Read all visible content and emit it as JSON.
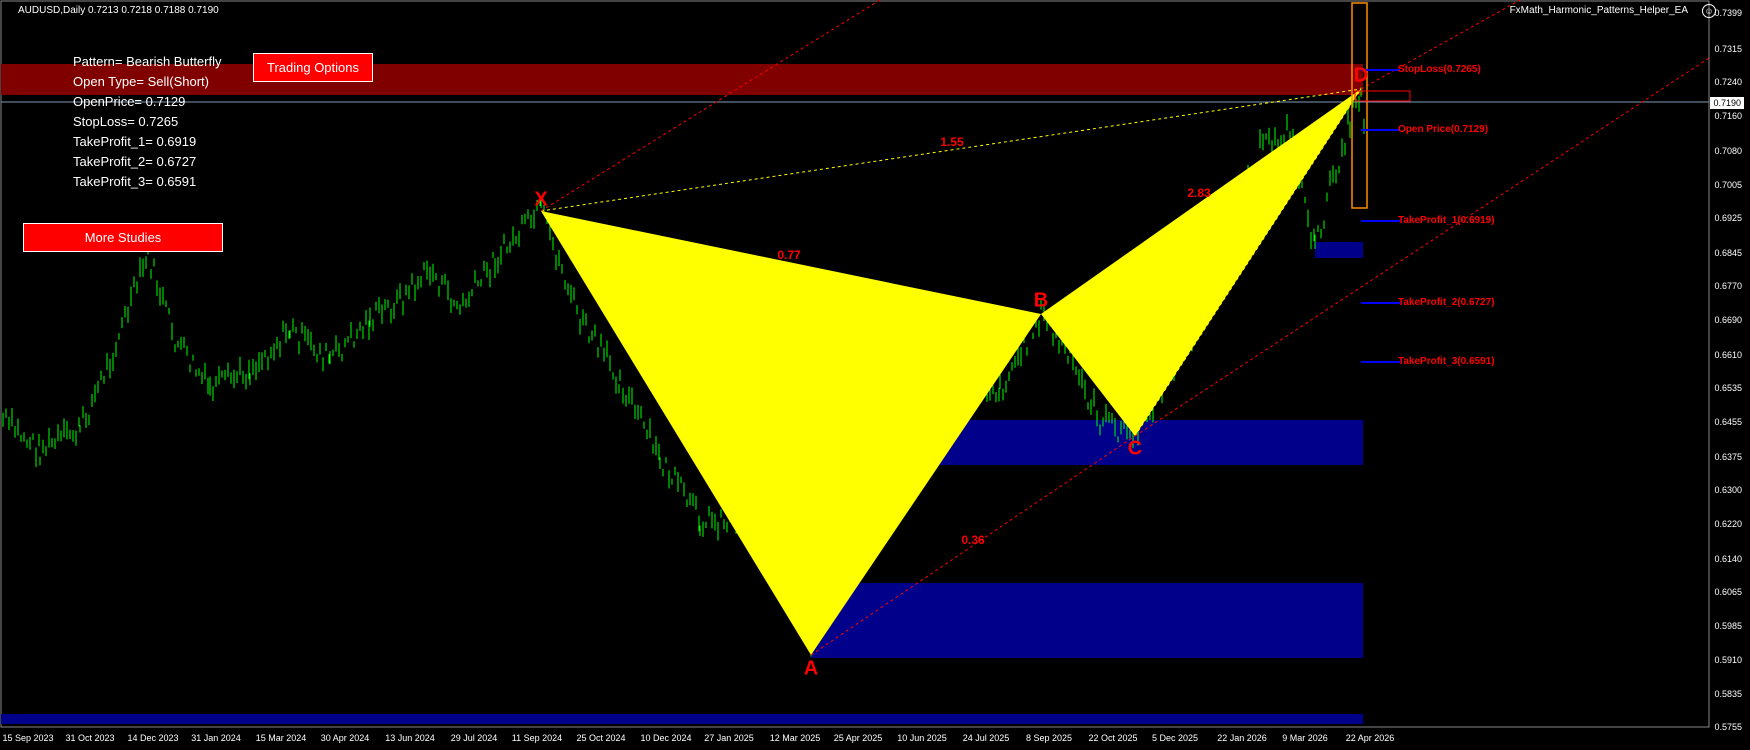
{
  "header": {
    "symbol": "AUDUSD,Daily  0.7213 0.7218 0.7188 0.7190",
    "ea_name": "FxMath_Harmonic_Patterns_Helper_EA",
    "ea_icon": "smiley-icon"
  },
  "info_panel": [
    "Pattern= Bearish Butterfly",
    "Open Type= Sell(Short)",
    "OpenPrice= 0.7129",
    "StopLoss= 0.7265",
    "TakeProfit_1= 0.6919",
    "TakeProfit_2= 0.6727",
    "TakeProfit_3= 0.6591"
  ],
  "buttons": {
    "trading_options": "Trading Options",
    "more_studies": "More Studies"
  },
  "price_axis": {
    "labels": [
      "0.7399",
      "0.7315",
      "0.7240",
      "0.7160",
      "0.7080",
      "0.7005",
      "0.6925",
      "0.6845",
      "0.6770",
      "0.6690",
      "0.6610",
      "0.6535",
      "0.6455",
      "0.6375",
      "0.6300",
      "0.6220",
      "0.6140",
      "0.6065",
      "0.5985",
      "0.5910",
      "0.5835",
      "0.5755"
    ],
    "current": "0.7190"
  },
  "date_axis": [
    "15 Sep 2023",
    "31 Oct 2023",
    "14 Dec 2023",
    "31 Jan 2024",
    "15 Mar 2024",
    "30 Apr 2024",
    "13 Jun 2024",
    "29 Jul 2024",
    "11 Sep 2024",
    "25 Oct 2024",
    "10 Dec 2024",
    "27 Jan 2025",
    "12 Mar 2025",
    "25 Apr 2025",
    "10 Jun 2025",
    "24 Jul 2025",
    "8 Sep 2025",
    "22 Oct 2025",
    "5 Dec 2025",
    "22 Jan 2026",
    "9 Mar 2026",
    "22 Apr 2026"
  ],
  "pattern_points": {
    "x": "X",
    "a": "A",
    "b": "B",
    "c": "C",
    "d": "D"
  },
  "ratios": {
    "xb": "0.77",
    "xd": "1.55",
    "bd": "2.83",
    "ac": "0.36"
  },
  "levels": {
    "stoploss": "StopLoss(0.7265)",
    "open": "Open Price(0.7129)",
    "tp1": "TakeProfit_1(0.6919)",
    "tp2": "TakeProfit_2(0.6727)",
    "tp3": "TakeProfit_3(0.6591)"
  },
  "colors": {
    "background": "#000000",
    "candles": "#00ff00",
    "pattern_fill": "#ffff00",
    "supply_zone": "#800000",
    "demand_zone": "#00008b",
    "level_line": "#0000ff",
    "label_red": "#ff0000"
  }
}
